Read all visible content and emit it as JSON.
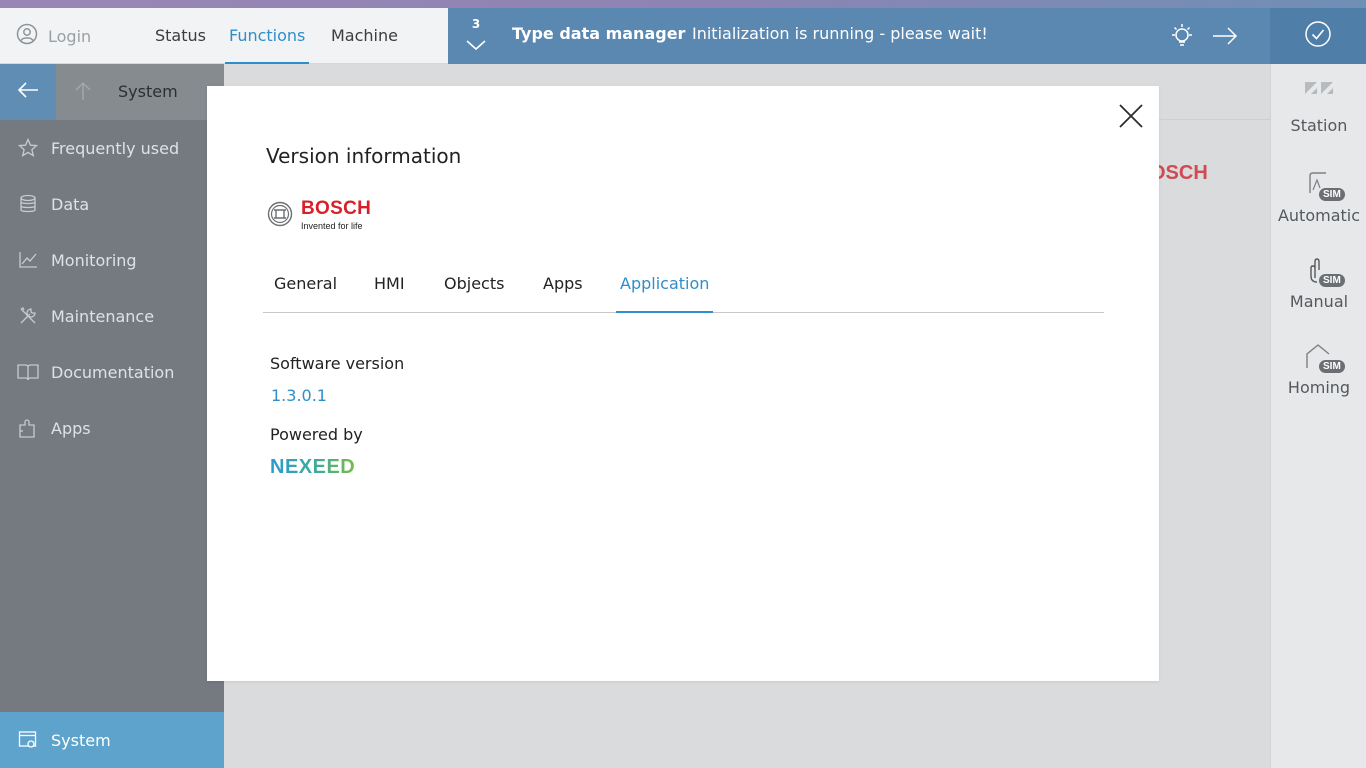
{
  "header": {
    "login_label": "Login",
    "nav_tabs": [
      {
        "label": "Status"
      },
      {
        "label": "Functions",
        "active": true
      },
      {
        "label": "Machine"
      }
    ]
  },
  "notification": {
    "count": "3",
    "title": "Type data manager",
    "message": "Initialization is running - please wait!",
    "bg_color": "#5a88b0"
  },
  "sidebar": {
    "breadcrumb": "System",
    "items": [
      {
        "label": "Frequently used",
        "icon": "star-icon"
      },
      {
        "label": "Data",
        "icon": "database-icon"
      },
      {
        "label": "Monitoring",
        "icon": "chart-icon"
      },
      {
        "label": "Maintenance",
        "icon": "tools-icon"
      },
      {
        "label": "Documentation",
        "icon": "book-icon"
      },
      {
        "label": "Apps",
        "icon": "puzzle-icon"
      }
    ],
    "active_item": {
      "label": "System",
      "icon": "system-settings-icon"
    }
  },
  "background": {
    "brand_text": "OSCH"
  },
  "right_panel": {
    "items": [
      {
        "label": "Station",
        "icon": "station-icon",
        "badge": ""
      },
      {
        "label": "Automatic",
        "icon": "automatic-icon",
        "badge": "SIM"
      },
      {
        "label": "Manual",
        "icon": "hand-icon",
        "badge": "SIM"
      },
      {
        "label": "Homing",
        "icon": "home-icon",
        "badge": "SIM"
      }
    ]
  },
  "dialog": {
    "title": "Version information",
    "logo": {
      "word": "BOSCH",
      "tagline": "Invented for life"
    },
    "tabs": [
      {
        "label": "General"
      },
      {
        "label": "HMI"
      },
      {
        "label": "Objects"
      },
      {
        "label": "Apps"
      },
      {
        "label": "Application",
        "active": true
      }
    ],
    "software_version_label": "Software version",
    "software_version": "1.3.0.1",
    "powered_by_label": "Powered by",
    "powered_by_brand": "NEXEED"
  },
  "colors": {
    "accent": "#2f8ec9",
    "sidebar_bg": "#757a80",
    "active_menu": "#5ea3cc",
    "bosch_red": "#d8202a"
  }
}
